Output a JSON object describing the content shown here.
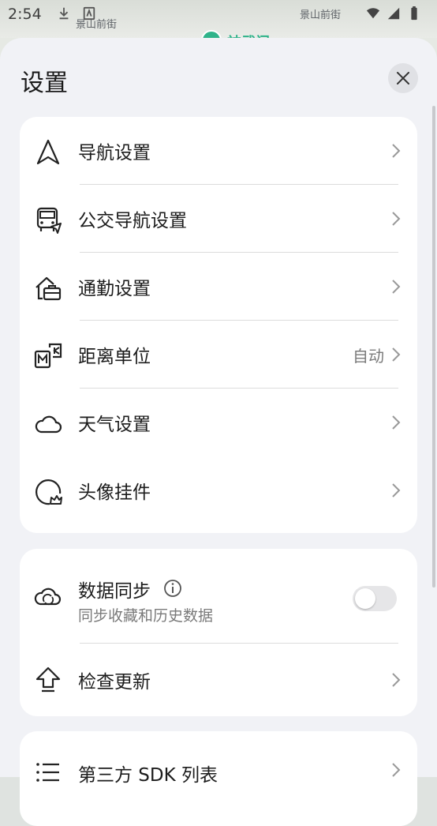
{
  "status_bar": {
    "time": "2:54",
    "icons": [
      "download-icon",
      "notification-icon",
      "wifi-icon",
      "signal-icon",
      "battery-icon"
    ]
  },
  "map": {
    "street_left": "景山前街",
    "street_right": "景山前街",
    "station_label": "神武门"
  },
  "sheet": {
    "title": "设置",
    "close_icon": "close-icon"
  },
  "group1": [
    {
      "label": "导航设置",
      "icon": "navigation-arrow-icon"
    },
    {
      "label": "公交导航设置",
      "icon": "bus-icon"
    },
    {
      "label": "通勤设置",
      "icon": "commute-briefcase-icon"
    },
    {
      "label": "距离单位",
      "icon": "distance-unit-icon",
      "value": "自动"
    },
    {
      "label": "天气设置",
      "icon": "cloud-icon"
    },
    {
      "label": "头像挂件",
      "icon": "avatar-pendant-icon"
    }
  ],
  "group2": {
    "sync": {
      "label": "数据同步",
      "subtitle": "同步收藏和历史数据",
      "enabled": false,
      "icon": "cloud-sync-icon"
    },
    "update": {
      "label": "检查更新",
      "icon": "update-arrow-icon"
    }
  },
  "group3": [
    {
      "label": "第三方 SDK 列表",
      "icon": "list-icon"
    }
  ],
  "colors": {
    "accent": "#2fb38a",
    "sheet_bg": "#f1f2f6",
    "card_bg": "#ffffff"
  }
}
